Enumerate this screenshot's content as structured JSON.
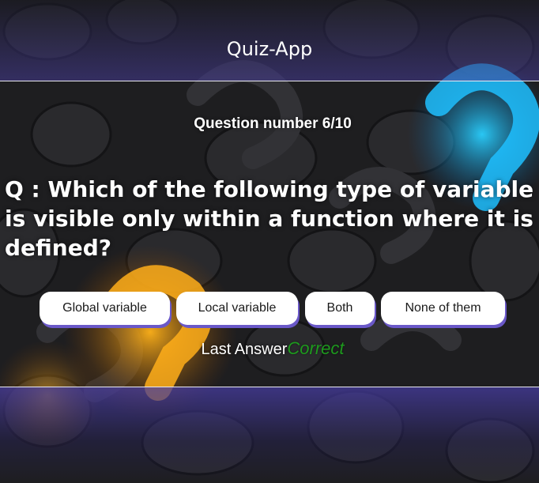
{
  "header": {
    "title": "Quiz-App"
  },
  "quiz": {
    "question_number_label": "Question number 6/10",
    "question_text": "Q : Which of the following type of variable is visible only within a function where it is defined?",
    "options": [
      {
        "label": "Global variable"
      },
      {
        "label": "Local variable"
      },
      {
        "label": "Both"
      },
      {
        "label": "None of them"
      }
    ],
    "last_answer_label": "Last Answer",
    "last_answer_value": "Correct"
  },
  "colors": {
    "correct": "#1e9a1e",
    "button_shadow": "#6a58c8",
    "band_accent": "#463c96",
    "glow_blue": "#1fb5f0",
    "glow_orange": "#f5a623"
  }
}
